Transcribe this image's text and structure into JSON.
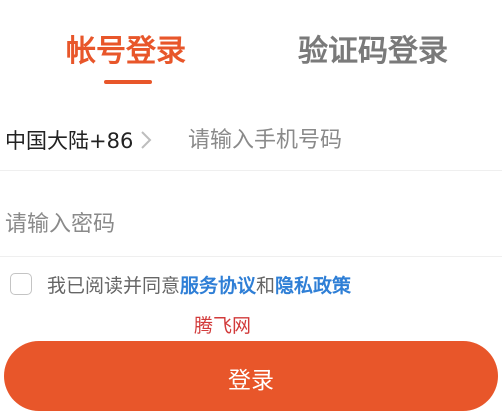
{
  "tabs": {
    "account_login": "帐号登录",
    "sms_login": "验证码登录",
    "active": "account_login"
  },
  "phone": {
    "region": "中国大陆+86",
    "placeholder": "请输入手机号码",
    "value": ""
  },
  "password": {
    "placeholder": "请输入密码",
    "value": ""
  },
  "agreement": {
    "checked": false,
    "prefix": "我已阅读并同意",
    "service_link": "服务协议",
    "connector": "和",
    "privacy_link": "隐私政策"
  },
  "watermark": "腾飞网",
  "login_button": "登录",
  "icons": {
    "region": "chevron-right-icon"
  },
  "colors": {
    "accent": "#e8562a",
    "link": "#2f7fd6",
    "inactive_tab": "#7a7a7a",
    "watermark": "#d23a3a"
  }
}
